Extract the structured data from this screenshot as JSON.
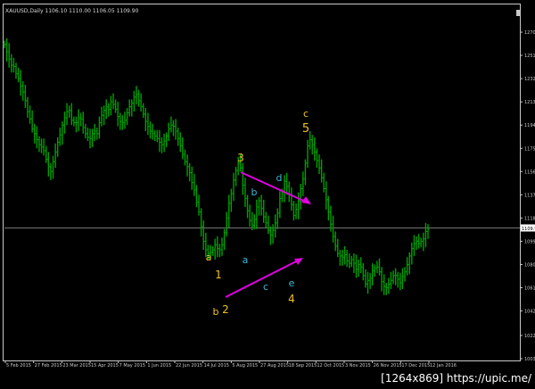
{
  "header": {
    "symbol_info": "XAUUSD,Daily 1106.10 1110.00 1106.05 1109.90"
  },
  "colors": {
    "background": "#000000",
    "bars": "#00a000",
    "axis": "#c8c8c8",
    "wave_yellow": "#f0c020",
    "wave_cyan": "#39b8d8",
    "trendline": "#e000e0",
    "price_line": "#9a9a9a"
  },
  "wave_labels": [
    {
      "text": "a",
      "tone": "yellow"
    },
    {
      "text": "1",
      "tone": "yellow"
    },
    {
      "text": "b",
      "tone": "yellow"
    },
    {
      "text": "2",
      "tone": "yellow"
    },
    {
      "text": "3",
      "tone": "yellow"
    },
    {
      "text": "b",
      "tone": "cyan"
    },
    {
      "text": "d",
      "tone": "cyan"
    },
    {
      "text": "a",
      "tone": "cyan"
    },
    {
      "text": "c",
      "tone": "cyan"
    },
    {
      "text": "e",
      "tone": "cyan"
    },
    {
      "text": "4",
      "tone": "yellow"
    },
    {
      "text": "c",
      "tone": "yellow"
    },
    {
      "text": "5",
      "tone": "yellow"
    }
  ],
  "price_marker": "1109.90",
  "watermark": "[1264x869] https://upic.me/",
  "chart_data": {
    "type": "bar",
    "title": "XAUUSD,Daily",
    "x_tick_labels": [
      "5 Feb 2015",
      "27 Feb 2015",
      "23 Mar 2015",
      "15 Apr 2015",
      "7 May 2015",
      "1 Jun 2015",
      "22 Jun 2015",
      "14 Jul 2015",
      "5 Aug 2015",
      "27 Aug 2015",
      "18 Sep 2015",
      "12 Oct 2015",
      "3 Nov 2015",
      "26 Nov 2015",
      "17 Dec 2015",
      "12 Jan 2016"
    ],
    "y_tick_labels": [
      "1270",
      "1251",
      "1232",
      "1213",
      "1194",
      "1175",
      "1156",
      "1137",
      "1118",
      "1099",
      "1080",
      "1061",
      "1042",
      "1022",
      "1003"
    ],
    "ylim": [
      1003,
      1289
    ],
    "grid": false,
    "series": [
      {
        "values": [
          1260,
          1254,
          1248,
          1243,
          1242,
          1236,
          1232,
          1226,
          1221,
          1214,
          1205,
          1199,
          1191,
          1187,
          1182,
          1178,
          1176,
          1173,
          1166,
          1160,
          1156,
          1164,
          1172,
          1180,
          1186,
          1194,
          1200,
          1205,
          1206,
          1198,
          1196,
          1196,
          1200,
          1199,
          1192,
          1187,
          1184,
          1183,
          1187,
          1189,
          1187,
          1196,
          1202,
          1206,
          1209,
          1207,
          1213,
          1211,
          1207,
          1201,
          1197,
          1196,
          1198,
          1204,
          1209,
          1212,
          1217,
          1219,
          1214,
          1209,
          1203,
          1197,
          1193,
          1189,
          1187,
          1185,
          1183,
          1180,
          1178,
          1181,
          1185,
          1191,
          1194,
          1193,
          1189,
          1183,
          1177,
          1170,
          1164,
          1160,
          1155,
          1147,
          1141,
          1131,
          1123,
          1111,
          1099,
          1092,
          1089,
          1090,
          1092,
          1096,
          1093,
          1092,
          1096,
          1106,
          1118,
          1130,
          1138,
          1149,
          1157,
          1163,
          1159,
          1145,
          1134,
          1124,
          1116,
          1112,
          1117,
          1127,
          1132,
          1126,
          1119,
          1114,
          1108,
          1104,
          1108,
          1114,
          1122,
          1134,
          1139,
          1148,
          1144,
          1137,
          1129,
          1120,
          1125,
          1132,
          1142,
          1150,
          1163,
          1177,
          1182,
          1178,
          1172,
          1165,
          1159,
          1151,
          1142,
          1133,
          1123,
          1113,
          1103,
          1095,
          1089,
          1087,
          1086,
          1088,
          1083,
          1081,
          1084,
          1081,
          1076,
          1080,
          1078,
          1071,
          1064,
          1067,
          1069,
          1075,
          1077,
          1078,
          1074,
          1066,
          1062,
          1061,
          1064,
          1067,
          1071,
          1071,
          1068,
          1065,
          1070,
          1074,
          1080,
          1087,
          1093,
          1097,
          1099,
          1097,
          1099,
          1101,
          1107,
          1109
        ]
      }
    ],
    "annotations": [
      "a",
      "1",
      "b",
      "2",
      "3",
      "b",
      "d",
      "a",
      "c",
      "e",
      "4",
      "c",
      "5"
    ]
  }
}
